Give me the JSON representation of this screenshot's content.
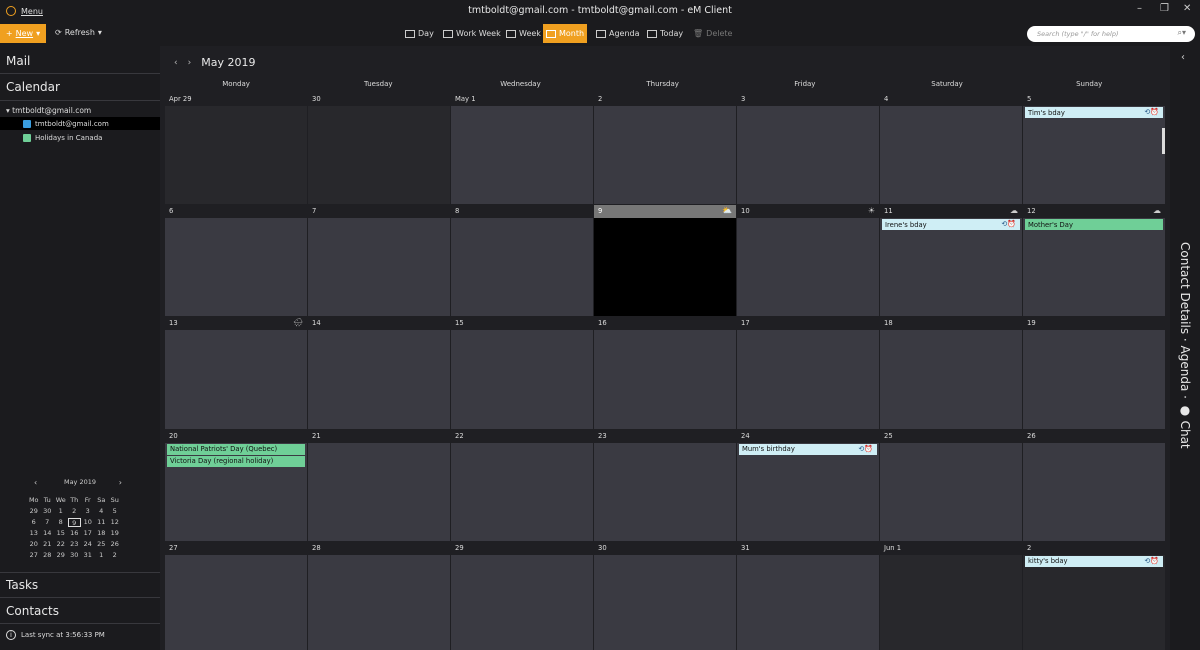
{
  "window": {
    "menu_label": "Menu",
    "title": "tmtboldt@gmail.com - tmtboldt@gmail.com - eM Client",
    "minimize": "–",
    "restore": "❐",
    "close": "✕"
  },
  "toolbar": {
    "new_label": "New",
    "refresh_label": "Refresh",
    "views": [
      {
        "label": "Day",
        "active": false
      },
      {
        "label": "Work Week",
        "active": false
      },
      {
        "label": "Week",
        "active": false
      },
      {
        "label": "Month",
        "active": true
      },
      {
        "label": "Agenda",
        "active": false
      },
      {
        "label": "Today",
        "active": false
      },
      {
        "label": "Delete",
        "active": false,
        "disabled": true
      }
    ],
    "search_placeholder": "Search (type \"/\" for help)"
  },
  "sidebar": {
    "mail_label": "Mail",
    "calendar_label": "Calendar",
    "account": "tmtboldt@gmail.com",
    "calendars": [
      {
        "label": "tmtboldt@gmail.com",
        "color": "#3b9ee0",
        "selected": true
      },
      {
        "label": "Holidays in Canada",
        "color": "#6fcf97",
        "selected": false
      }
    ],
    "mini_calendar": {
      "month_label": "May 2019",
      "weekday_headers": [
        "Mo",
        "Tu",
        "We",
        "Th",
        "Fr",
        "Sa",
        "Su"
      ],
      "weeks": [
        [
          "29",
          "30",
          "1",
          "2",
          "3",
          "4",
          "5"
        ],
        [
          "6",
          "7",
          "8",
          "9",
          "10",
          "11",
          "12"
        ],
        [
          "13",
          "14",
          "15",
          "16",
          "17",
          "18",
          "19"
        ],
        [
          "20",
          "21",
          "22",
          "23",
          "24",
          "25",
          "26"
        ],
        [
          "27",
          "28",
          "29",
          "30",
          "31",
          "1",
          "2"
        ]
      ],
      "today": "9"
    },
    "tasks_label": "Tasks",
    "contacts_label": "Contacts",
    "sync_status": "Last sync at 3:56:33 PM"
  },
  "calendar": {
    "month_title": "May 2019",
    "weekdays": [
      "Monday",
      "Tuesday",
      "Wednesday",
      "Thursday",
      "Friday",
      "Saturday",
      "Sunday"
    ],
    "weeks": [
      [
        {
          "label": "Apr 29",
          "other": true
        },
        {
          "label": "30",
          "other": true
        },
        {
          "label": "May 1"
        },
        {
          "label": "2"
        },
        {
          "label": "3"
        },
        {
          "label": "4"
        },
        {
          "label": "5",
          "events": [
            {
              "title": "Tim's bday",
              "type": "bday"
            }
          ]
        }
      ],
      [
        {
          "label": "6"
        },
        {
          "label": "7"
        },
        {
          "label": "8"
        },
        {
          "label": "9",
          "today": true,
          "weather": "⛅"
        },
        {
          "label": "10",
          "weather": "☀"
        },
        {
          "label": "11",
          "weather": "☁",
          "events": [
            {
              "title": "Irene's bday",
              "type": "bday"
            }
          ]
        },
        {
          "label": "12",
          "weather": "☁",
          "events": [
            {
              "title": "Mother's Day",
              "type": "holiday"
            }
          ]
        }
      ],
      [
        {
          "label": "13",
          "weather": "🌧"
        },
        {
          "label": "14"
        },
        {
          "label": "15"
        },
        {
          "label": "16"
        },
        {
          "label": "17"
        },
        {
          "label": "18"
        },
        {
          "label": "19"
        }
      ],
      [
        {
          "label": "20",
          "events": [
            {
              "title": "National Patriots' Day (Quebec)",
              "type": "holiday"
            },
            {
              "title": "Victoria Day (regional holiday)",
              "type": "holiday"
            }
          ]
        },
        {
          "label": "21"
        },
        {
          "label": "22"
        },
        {
          "label": "23"
        },
        {
          "label": "24",
          "events": [
            {
              "title": "Mum's birthday",
              "type": "bday"
            }
          ]
        },
        {
          "label": "25"
        },
        {
          "label": "26"
        }
      ],
      [
        {
          "label": "27"
        },
        {
          "label": "28"
        },
        {
          "label": "29"
        },
        {
          "label": "30"
        },
        {
          "label": "31"
        },
        {
          "label": "Jun 1",
          "other": true
        },
        {
          "label": "2",
          "other": true,
          "events": [
            {
              "title": "kitty's bday",
              "type": "bday"
            }
          ]
        }
      ]
    ]
  },
  "right_rail": {
    "collapse_icon": "‹",
    "panel_label": "Contact Details  ·  Agenda  ·  ● Chat"
  }
}
